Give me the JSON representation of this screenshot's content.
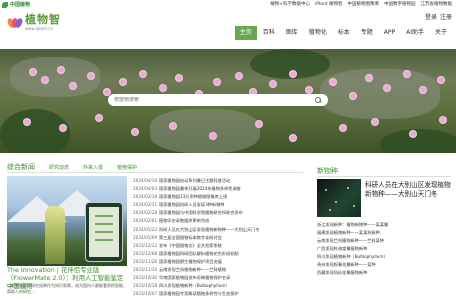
{
  "topbar": {
    "brand": "中国植物",
    "links": [
      "植物+科学数据中心",
      "iPlant 植物智",
      "中国植物图像库",
      "中国数字植物园",
      "江苏省植物数据"
    ]
  },
  "header": {
    "logo_cn": "植物智",
    "logo_url": "www.iplant.cn",
    "login": "登录",
    "register": "注册"
  },
  "nav": [
    "主页",
    "百科",
    "图库",
    "植物化",
    "标本",
    "专题",
    "APP",
    "AI助手",
    "关于"
  ],
  "hero": {
    "search_placeholder": "按植物搜索"
  },
  "news": {
    "tabs": [
      "综合新闻",
      "研究动态",
      "外来入侵",
      "植物保护"
    ],
    "feature_caption": "The Innovation | 花伴侣专业版（FlowerMate 2.0）：利用人工智能鉴定中国植物",
    "feature_desc": "以植物分类学研究成果作为知识背景，成为国内人都能看到的智能，帮助人的研究...",
    "items": [
      {
        "date": "2024/04/16",
        "title": "国家植物园启动系列春日主题科普活动"
      },
      {
        "date": "2024/04/03",
        "title": "国家植物园春季开展2024年植物多样性调查"
      },
      {
        "date": "2024/03/18",
        "title": "国家植物园13万余种植物图像库上线"
      },
      {
        "date": "2024/03/11",
        "title": "国家植物园科研人员发现3种新物种"
      },
      {
        "date": "2024/02/28",
        "title": "国家植物园与中国科学院植物研究所联合发布"
      },
      {
        "date": "2024/02/01",
        "title": "植物学名录数据库更新完成"
      },
      {
        "date": "2024/01/22",
        "title": "科研人员在大别山区发现植物新物种——大别山天门冬"
      },
      {
        "date": "2024/01/09",
        "title": "第三届全国植物标本数字化研讨会"
      },
      {
        "date": "2023/12/22",
        "title": "发布《中国植物志》全文检索系统"
      },
      {
        "date": "2023/12/08",
        "title": "国家植物园科研团队解析植物花色形成机制"
      },
      {
        "date": "2023/11/26",
        "title": "国家植物园野生植物保护项目进展"
      },
      {
        "date": "2023/11/10",
        "title": "云南发现兰科植物新种——兰科植物"
      },
      {
        "date": "2023/10/30",
        "title": "华南国家植物园发布珍稀植物保护名录"
      },
      {
        "date": "2023/10/18",
        "title": "四川发现植物新种（Bulbophyllum）"
      },
      {
        "date": "2023/10/07",
        "title": "国家植物园专家解读植物多样性与生态保护"
      }
    ]
  },
  "species": {
    "heading": "新物种",
    "featured_title": "科研人员在大别山区发现植物新物种——大别山天门冬",
    "items": [
      "浙江发现新种：植物新物种——某某属",
      "福建发现植物新种——某某科新种",
      "云南发现兰科植物新种——兰科某种",
      "广西发现秋海棠属植物新种",
      "四川发现植物新种（Bulbophyllum）",
      "贵州发现报春花属新种——某种",
      "西藏发现凤仙花属植物新种"
    ]
  }
}
